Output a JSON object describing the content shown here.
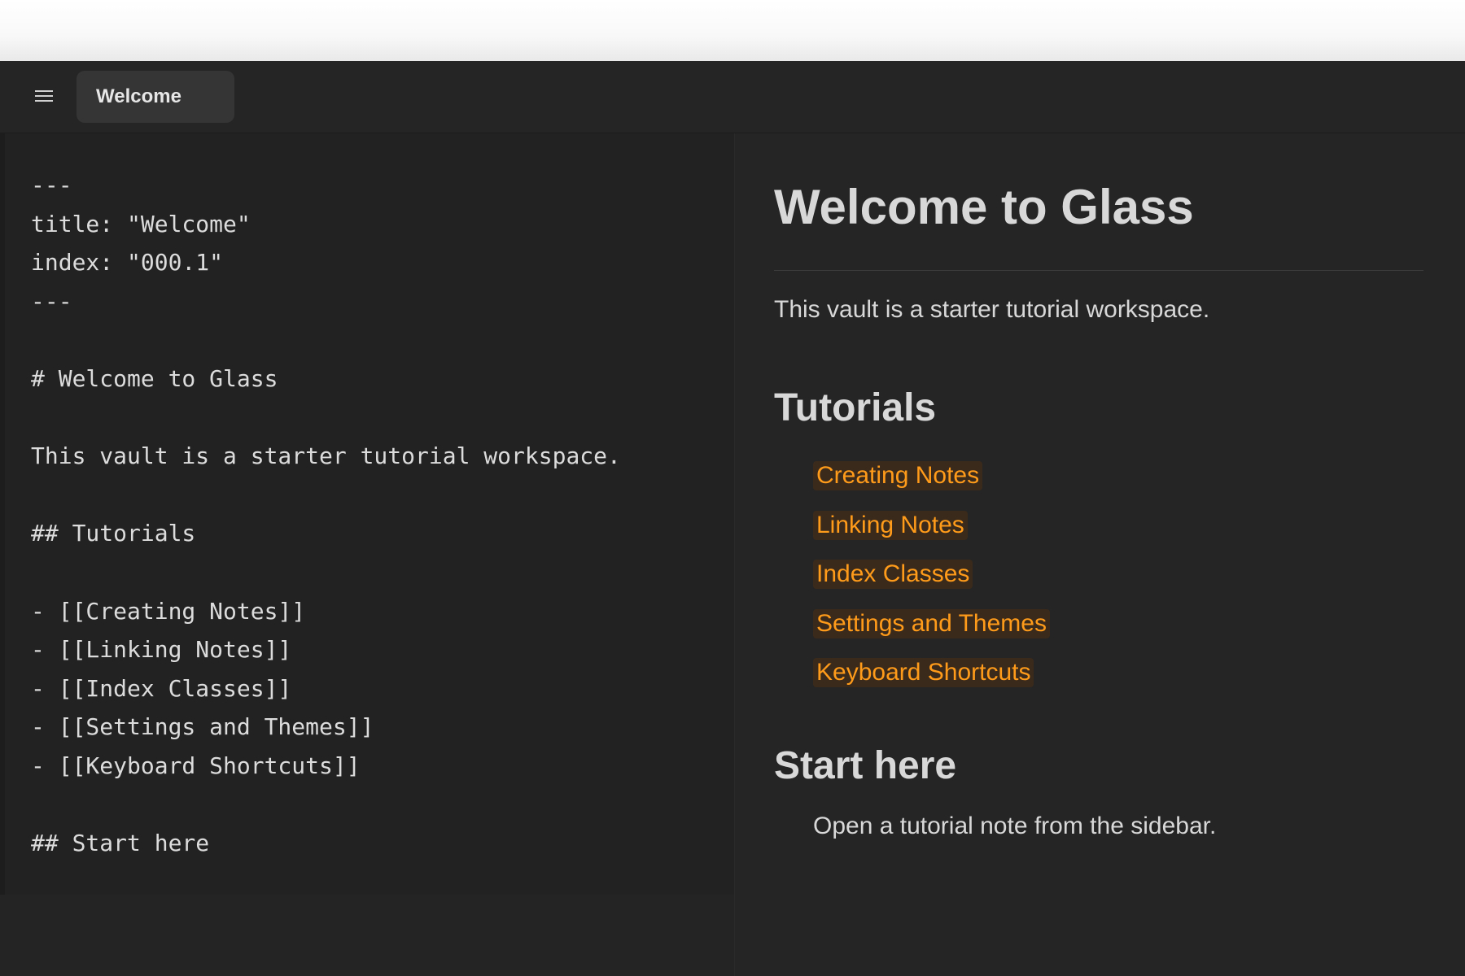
{
  "tab": {
    "title": "Welcome"
  },
  "editor": {
    "lines": [
      "---",
      "title: \"Welcome\"",
      "index: \"000.1\"",
      "---",
      "",
      "# Welcome to Glass",
      "",
      "This vault is a starter tutorial workspace.",
      "",
      "## Tutorials",
      "",
      "- [[Creating Notes]]",
      "- [[Linking Notes]]",
      "- [[Index Classes]]",
      "- [[Settings and Themes]]",
      "- [[Keyboard Shortcuts]]",
      "",
      "## Start here"
    ]
  },
  "preview": {
    "title": "Welcome to Glass",
    "intro": "This vault is a starter tutorial workspace.",
    "tutorials_heading": "Tutorials",
    "tutorials": [
      "Creating Notes",
      "Linking Notes",
      "Index Classes",
      "Settings and Themes",
      "Keyboard Shortcuts"
    ],
    "start_heading": "Start here",
    "start_text": "Open a tutorial note from the sidebar."
  },
  "colors": {
    "background": "#242424",
    "link": "#ff9b1a",
    "link_background": "#3a2a1c",
    "text": "#d8d8d8"
  },
  "icons": {
    "menu": "hamburger-menu-icon"
  }
}
